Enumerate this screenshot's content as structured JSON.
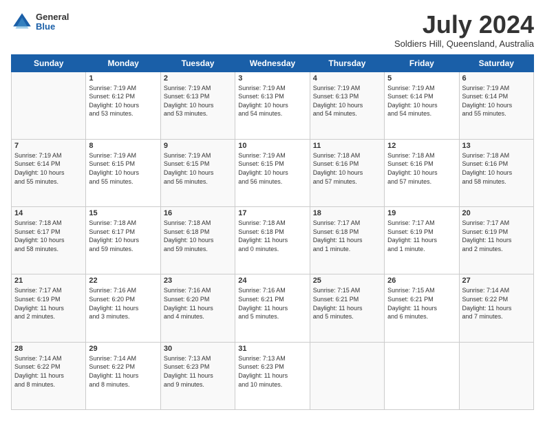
{
  "header": {
    "logo": {
      "general": "General",
      "blue": "Blue"
    },
    "title": "July 2024",
    "location": "Soldiers Hill, Queensland, Australia"
  },
  "days_of_week": [
    "Sunday",
    "Monday",
    "Tuesday",
    "Wednesday",
    "Thursday",
    "Friday",
    "Saturday"
  ],
  "weeks": [
    [
      {
        "day": "",
        "info": ""
      },
      {
        "day": "1",
        "info": "Sunrise: 7:19 AM\nSunset: 6:12 PM\nDaylight: 10 hours\nand 53 minutes."
      },
      {
        "day": "2",
        "info": "Sunrise: 7:19 AM\nSunset: 6:13 PM\nDaylight: 10 hours\nand 53 minutes."
      },
      {
        "day": "3",
        "info": "Sunrise: 7:19 AM\nSunset: 6:13 PM\nDaylight: 10 hours\nand 54 minutes."
      },
      {
        "day": "4",
        "info": "Sunrise: 7:19 AM\nSunset: 6:13 PM\nDaylight: 10 hours\nand 54 minutes."
      },
      {
        "day": "5",
        "info": "Sunrise: 7:19 AM\nSunset: 6:14 PM\nDaylight: 10 hours\nand 54 minutes."
      },
      {
        "day": "6",
        "info": "Sunrise: 7:19 AM\nSunset: 6:14 PM\nDaylight: 10 hours\nand 55 minutes."
      }
    ],
    [
      {
        "day": "7",
        "info": "Sunrise: 7:19 AM\nSunset: 6:14 PM\nDaylight: 10 hours\nand 55 minutes."
      },
      {
        "day": "8",
        "info": "Sunrise: 7:19 AM\nSunset: 6:15 PM\nDaylight: 10 hours\nand 55 minutes."
      },
      {
        "day": "9",
        "info": "Sunrise: 7:19 AM\nSunset: 6:15 PM\nDaylight: 10 hours\nand 56 minutes."
      },
      {
        "day": "10",
        "info": "Sunrise: 7:19 AM\nSunset: 6:15 PM\nDaylight: 10 hours\nand 56 minutes."
      },
      {
        "day": "11",
        "info": "Sunrise: 7:18 AM\nSunset: 6:16 PM\nDaylight: 10 hours\nand 57 minutes."
      },
      {
        "day": "12",
        "info": "Sunrise: 7:18 AM\nSunset: 6:16 PM\nDaylight: 10 hours\nand 57 minutes."
      },
      {
        "day": "13",
        "info": "Sunrise: 7:18 AM\nSunset: 6:16 PM\nDaylight: 10 hours\nand 58 minutes."
      }
    ],
    [
      {
        "day": "14",
        "info": "Sunrise: 7:18 AM\nSunset: 6:17 PM\nDaylight: 10 hours\nand 58 minutes."
      },
      {
        "day": "15",
        "info": "Sunrise: 7:18 AM\nSunset: 6:17 PM\nDaylight: 10 hours\nand 59 minutes."
      },
      {
        "day": "16",
        "info": "Sunrise: 7:18 AM\nSunset: 6:18 PM\nDaylight: 10 hours\nand 59 minutes."
      },
      {
        "day": "17",
        "info": "Sunrise: 7:18 AM\nSunset: 6:18 PM\nDaylight: 11 hours\nand 0 minutes."
      },
      {
        "day": "18",
        "info": "Sunrise: 7:17 AM\nSunset: 6:18 PM\nDaylight: 11 hours\nand 1 minute."
      },
      {
        "day": "19",
        "info": "Sunrise: 7:17 AM\nSunset: 6:19 PM\nDaylight: 11 hours\nand 1 minute."
      },
      {
        "day": "20",
        "info": "Sunrise: 7:17 AM\nSunset: 6:19 PM\nDaylight: 11 hours\nand 2 minutes."
      }
    ],
    [
      {
        "day": "21",
        "info": "Sunrise: 7:17 AM\nSunset: 6:19 PM\nDaylight: 11 hours\nand 2 minutes."
      },
      {
        "day": "22",
        "info": "Sunrise: 7:16 AM\nSunset: 6:20 PM\nDaylight: 11 hours\nand 3 minutes."
      },
      {
        "day": "23",
        "info": "Sunrise: 7:16 AM\nSunset: 6:20 PM\nDaylight: 11 hours\nand 4 minutes."
      },
      {
        "day": "24",
        "info": "Sunrise: 7:16 AM\nSunset: 6:21 PM\nDaylight: 11 hours\nand 5 minutes."
      },
      {
        "day": "25",
        "info": "Sunrise: 7:15 AM\nSunset: 6:21 PM\nDaylight: 11 hours\nand 5 minutes."
      },
      {
        "day": "26",
        "info": "Sunrise: 7:15 AM\nSunset: 6:21 PM\nDaylight: 11 hours\nand 6 minutes."
      },
      {
        "day": "27",
        "info": "Sunrise: 7:14 AM\nSunset: 6:22 PM\nDaylight: 11 hours\nand 7 minutes."
      }
    ],
    [
      {
        "day": "28",
        "info": "Sunrise: 7:14 AM\nSunset: 6:22 PM\nDaylight: 11 hours\nand 8 minutes."
      },
      {
        "day": "29",
        "info": "Sunrise: 7:14 AM\nSunset: 6:22 PM\nDaylight: 11 hours\nand 8 minutes."
      },
      {
        "day": "30",
        "info": "Sunrise: 7:13 AM\nSunset: 6:23 PM\nDaylight: 11 hours\nand 9 minutes."
      },
      {
        "day": "31",
        "info": "Sunrise: 7:13 AM\nSunset: 6:23 PM\nDaylight: 11 hours\nand 10 minutes."
      },
      {
        "day": "",
        "info": ""
      },
      {
        "day": "",
        "info": ""
      },
      {
        "day": "",
        "info": ""
      }
    ]
  ]
}
